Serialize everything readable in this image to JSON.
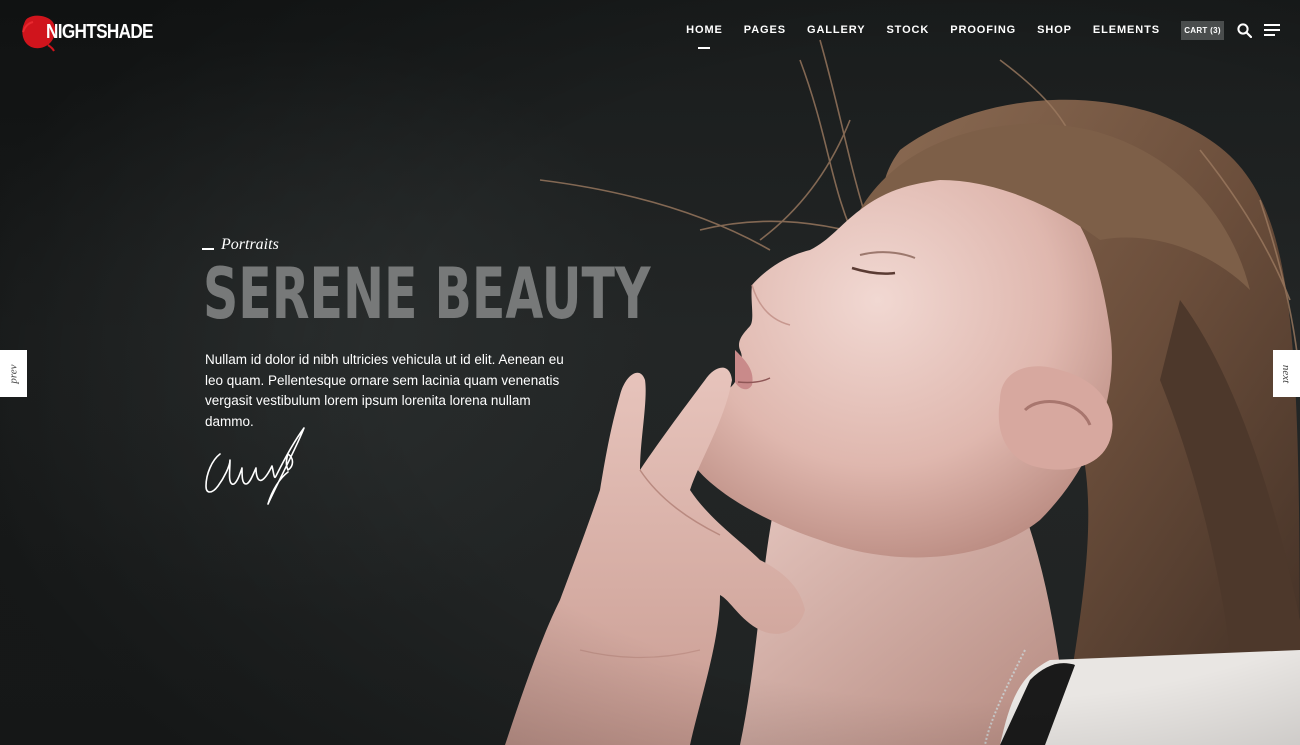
{
  "brand": {
    "name": "NIGHTSHADE",
    "accent": "#d0141c"
  },
  "nav": {
    "items": [
      {
        "label": "HOME",
        "active": true
      },
      {
        "label": "PAGES",
        "active": false
      },
      {
        "label": "GALLERY",
        "active": false
      },
      {
        "label": "STOCK",
        "active": false
      },
      {
        "label": "PROOFING",
        "active": false
      },
      {
        "label": "SHOP",
        "active": false
      },
      {
        "label": "ELEMENTS",
        "active": false
      }
    ],
    "cart_label": "CART (3)",
    "search_icon": "search-icon",
    "menu_icon": "hamburger-menu-icon"
  },
  "hero": {
    "category": "Portraits",
    "title": "SERENE BEAUTY",
    "description": "Nullam id dolor id nibh ultricies vehicula ut id elit. Aenean eu leo quam. Pellentesque ornare sem lacinia quam venenatis vergasit vestibulum lorem ipsum lorenita lorena nullam dammo.",
    "photo": "portrait-woman-profile",
    "title_color": "#777979",
    "background_color": "#1f2222"
  },
  "slider": {
    "prev_label": "prev",
    "next_label": "next"
  }
}
